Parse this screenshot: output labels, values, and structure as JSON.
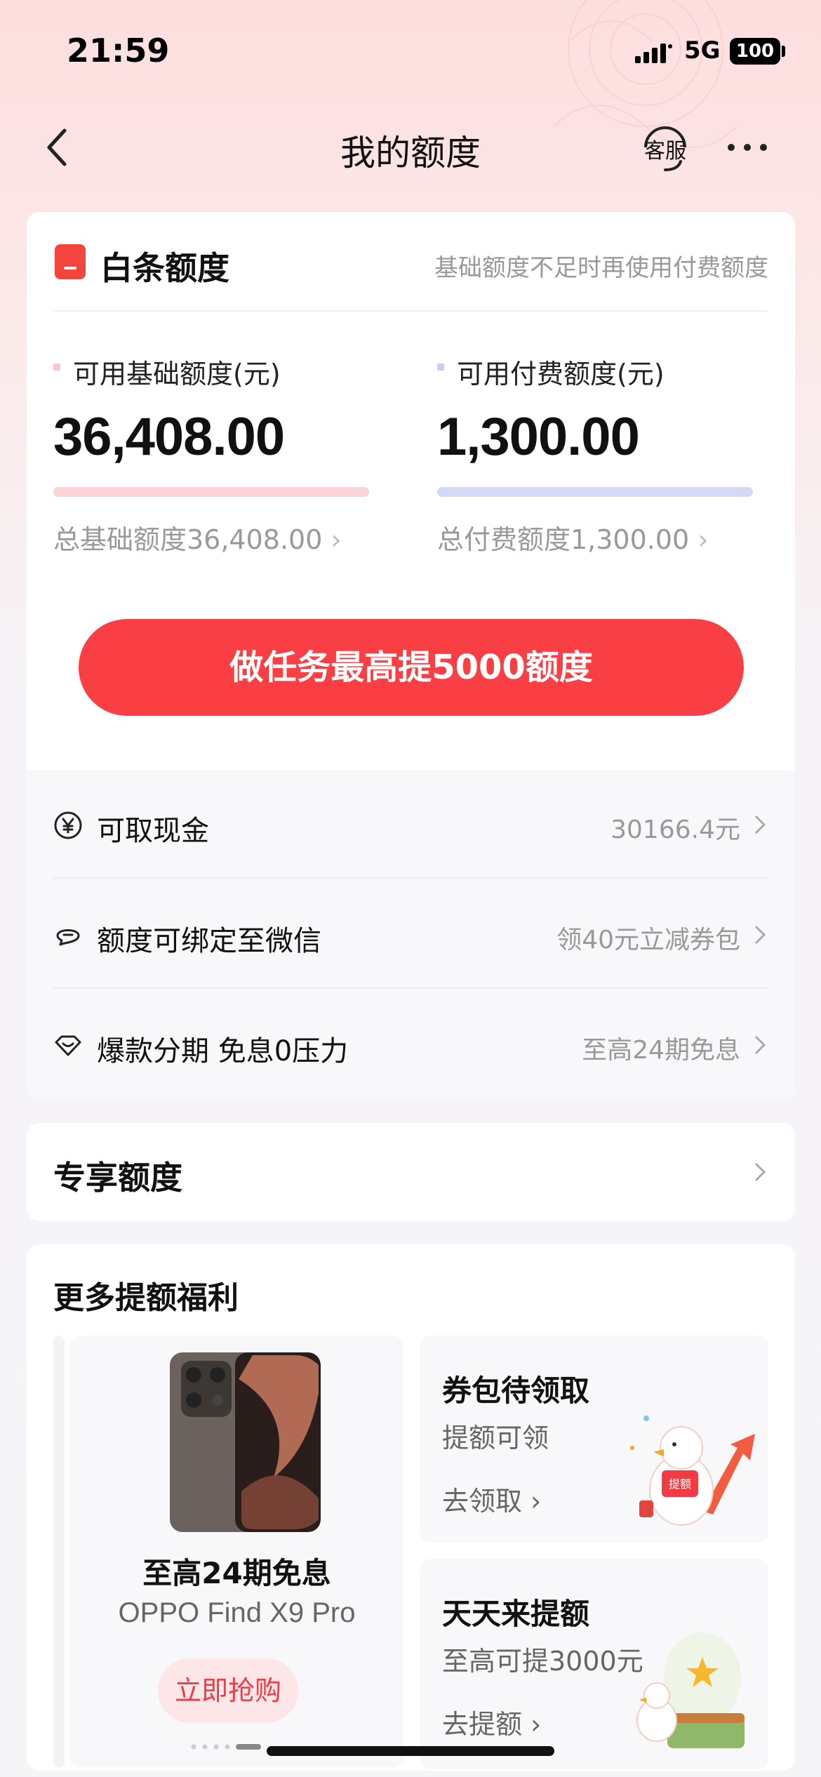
{
  "status_bar": {
    "time": "21:59",
    "network": "5G",
    "battery": "100"
  },
  "nav": {
    "title": "我的额度",
    "service_label": "客服"
  },
  "baitiao": {
    "title": "白条额度",
    "hint": "基础额度不足时再使用付费额度",
    "base": {
      "label": "可用基础额度(元)",
      "value": "36,408.00",
      "total": "总基础额度36,408.00",
      "color": "#fcd3d6",
      "fill_percent": 100
    },
    "paid": {
      "label": "可用付费额度(元)",
      "value": "1,300.00",
      "total": "总付费额度1,300.00",
      "color": "#d5d9f8",
      "fill_percent": 100
    },
    "task_button": "做任务最高提5000额度"
  },
  "features": [
    {
      "icon": "yen-icon",
      "label": "可取现金",
      "right": "30166.4元"
    },
    {
      "icon": "chat-icon",
      "label": "额度可绑定至微信",
      "right": "领40元立减券包"
    },
    {
      "icon": "heart-icon",
      "label": "爆款分期 免息0压力",
      "right": "至高24期免息"
    }
  ],
  "exclusive": {
    "title": "专享额度"
  },
  "more_benefits": {
    "title": "更多提额福利",
    "product": {
      "title": "至高24期免息",
      "name": "OPPO Find X9 Pro",
      "button": "立即抢购"
    },
    "cards": [
      {
        "title": "券包待领取",
        "sub": "提额可领",
        "link": "去领取",
        "badge": "提额"
      },
      {
        "title": "天天来提额",
        "sub": "至高可提3000元",
        "link": "去提额"
      }
    ]
  },
  "colors": {
    "accent": "#fa3f44",
    "brand_red": "#f4453d"
  }
}
